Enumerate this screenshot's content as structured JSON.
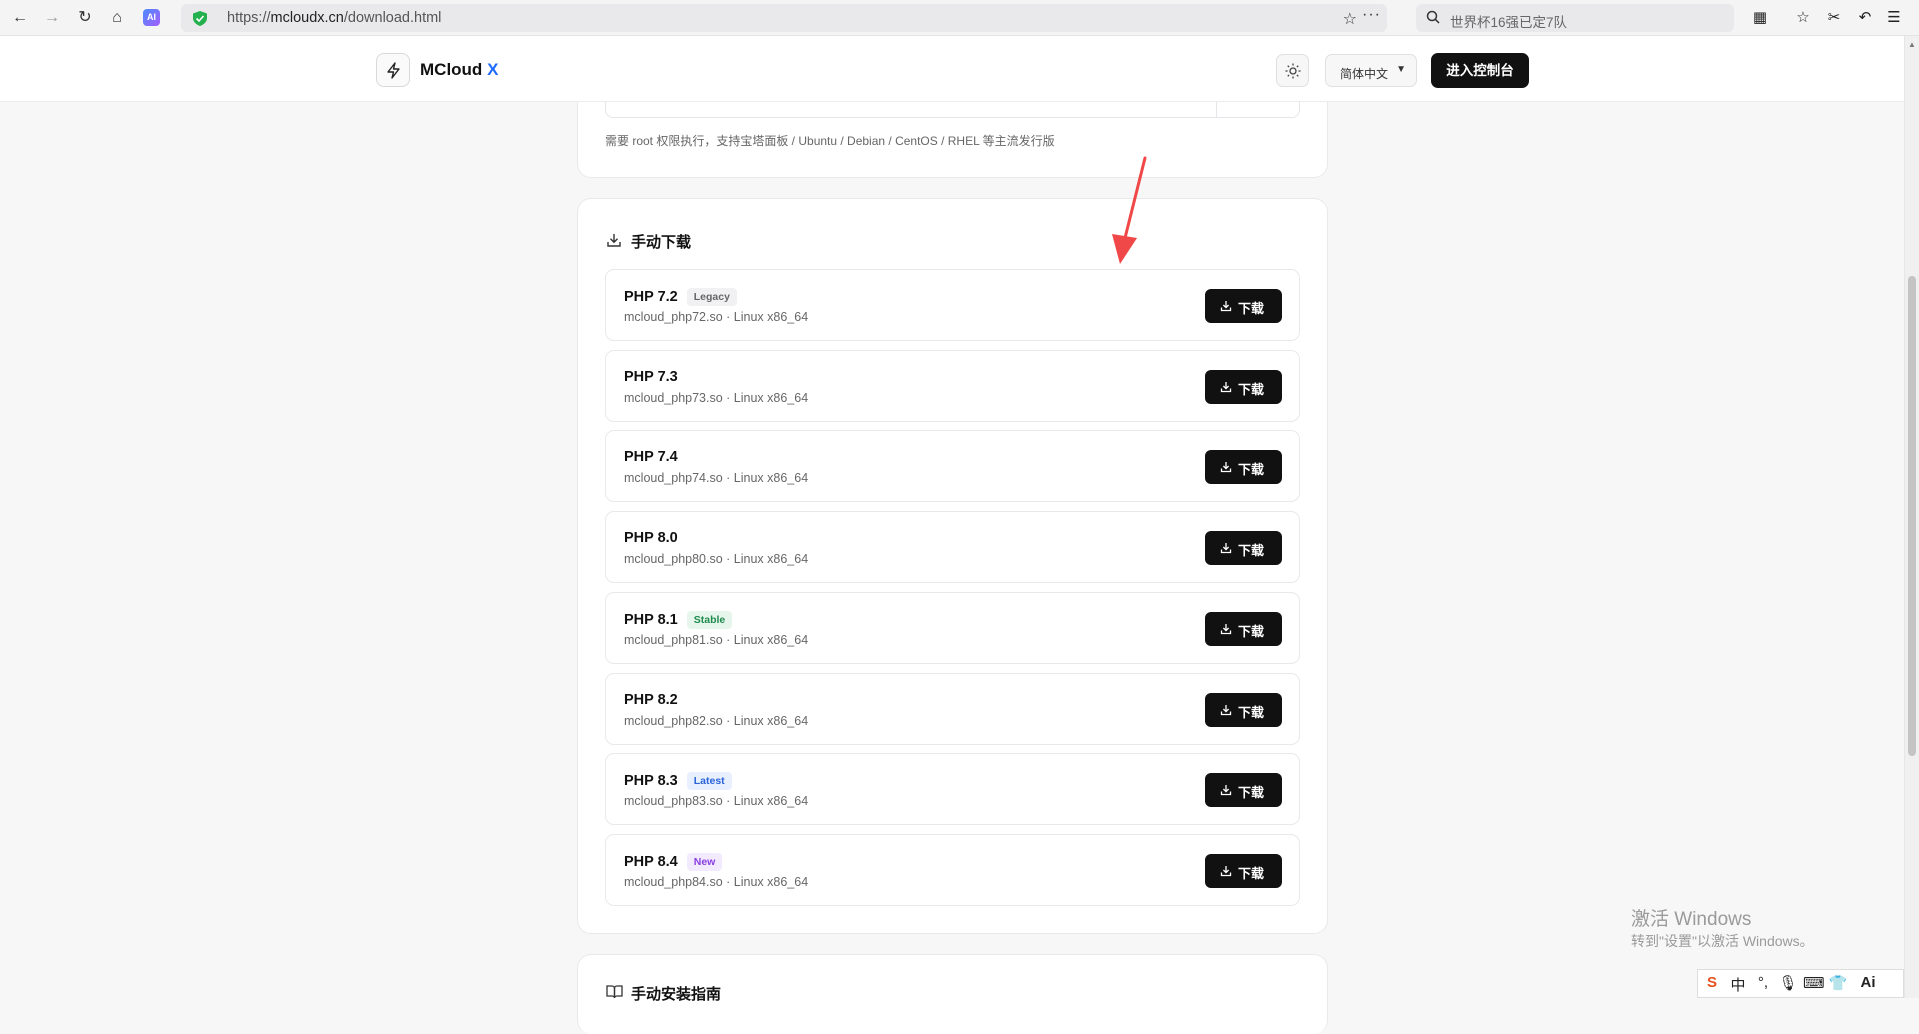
{
  "browser": {
    "url_prefix": "https://",
    "url_domain": "mcloudx.cn",
    "url_path": "/download.html",
    "search_text": "世界杯16强已定7队",
    "ai_badge": "AI"
  },
  "header": {
    "logo_main": "MCloud",
    "logo_accent": "X",
    "language": "简体中文",
    "console_button": "进入控制台"
  },
  "install": {
    "note": "需要 root 权限执行，支持宝塔面板 / Ubuntu / Debian / CentOS / RHEL 等主流发行版"
  },
  "manual_download": {
    "title": "手动下载",
    "button_label": "下载",
    "items": [
      {
        "version": "PHP 7.2",
        "tag": "Legacy",
        "file": "mcloud_php72.so · Linux x86_64"
      },
      {
        "version": "PHP 7.3",
        "tag": "",
        "file": "mcloud_php73.so · Linux x86_64"
      },
      {
        "version": "PHP 7.4",
        "tag": "",
        "file": "mcloud_php74.so · Linux x86_64"
      },
      {
        "version": "PHP 8.0",
        "tag": "",
        "file": "mcloud_php80.so · Linux x86_64"
      },
      {
        "version": "PHP 8.1",
        "tag": "Stable",
        "file": "mcloud_php81.so · Linux x86_64"
      },
      {
        "version": "PHP 8.2",
        "tag": "",
        "file": "mcloud_php82.so · Linux x86_64"
      },
      {
        "version": "PHP 8.3",
        "tag": "Latest",
        "file": "mcloud_php83.so · Linux x86_64"
      },
      {
        "version": "PHP 8.4",
        "tag": "New",
        "file": "mcloud_php84.so · Linux x86_64"
      }
    ]
  },
  "guide": {
    "title": "手动安装指南"
  },
  "watermark": {
    "line1": "激活 Windows",
    "line2": "转到\"设置\"以激活 Windows。"
  },
  "ime": {
    "items": [
      "S",
      "中",
      "°,",
      "🎙",
      "⌨",
      "👕",
      "Ai"
    ]
  },
  "colors": {
    "accent": "#1f6bff",
    "button_dark": "#111111",
    "annotation_arrow": "#f04848"
  }
}
